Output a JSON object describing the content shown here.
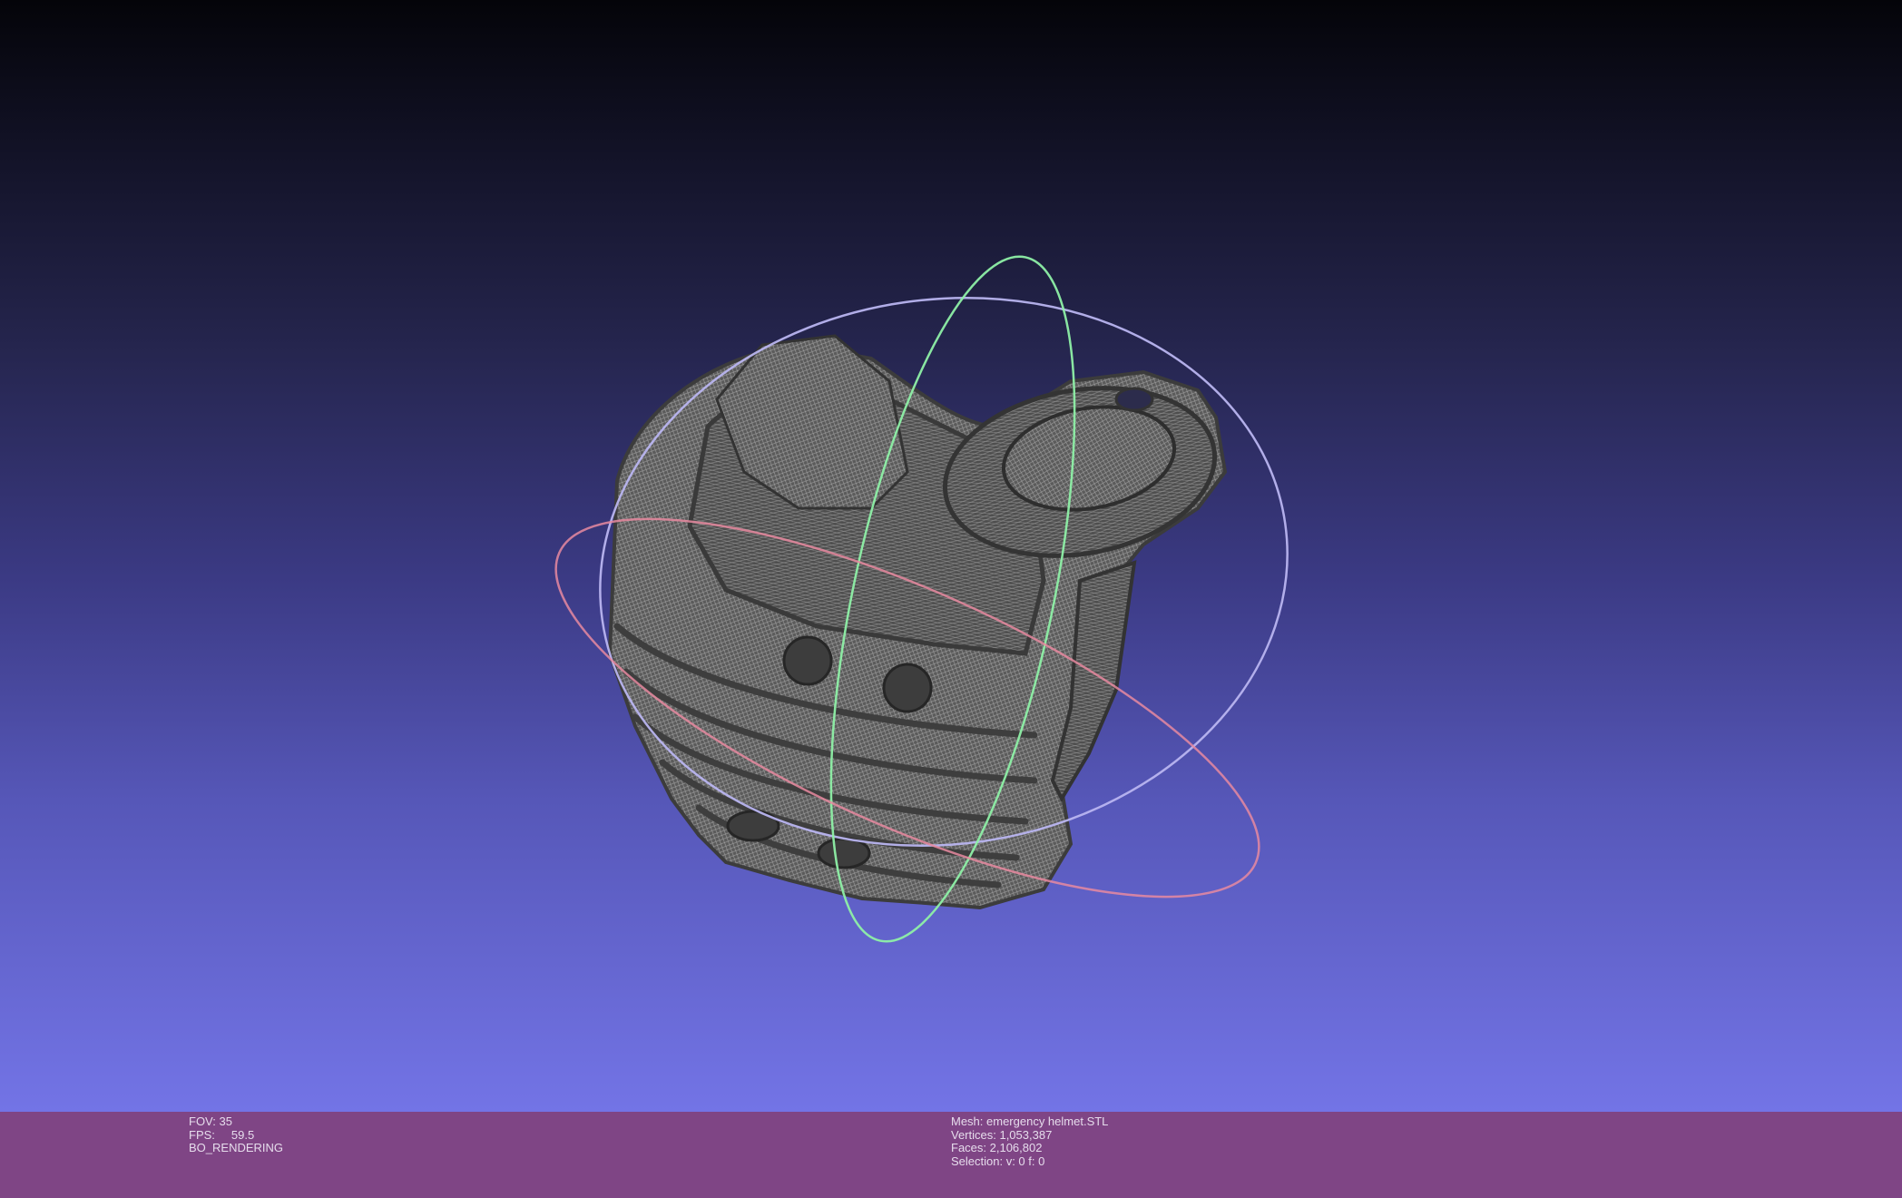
{
  "viewport": {
    "background_top": "#040409",
    "background_bottom": "#7374e6",
    "mesh_color": "#5b5b5b",
    "wire_color": "#9a9a9a",
    "trackball_colors": {
      "x_ring": "#e88aa0",
      "y_ring": "#8ef0a6",
      "z_ring": "#b9b5f0"
    }
  },
  "info": {
    "fov_label": "FOV:",
    "fov_value": "35",
    "fps_label": "FPS:",
    "fps_value": "59.5",
    "render_mode": "BO_RENDERING",
    "mesh_line": "Mesh: emergency helmet.STL",
    "vertices_line": "Vertices: 1,053,387",
    "faces_line": "Faces: 2,106,802",
    "selection_line": "Selection: v: 0 f: 0"
  },
  "bar_color": "#7f4585"
}
